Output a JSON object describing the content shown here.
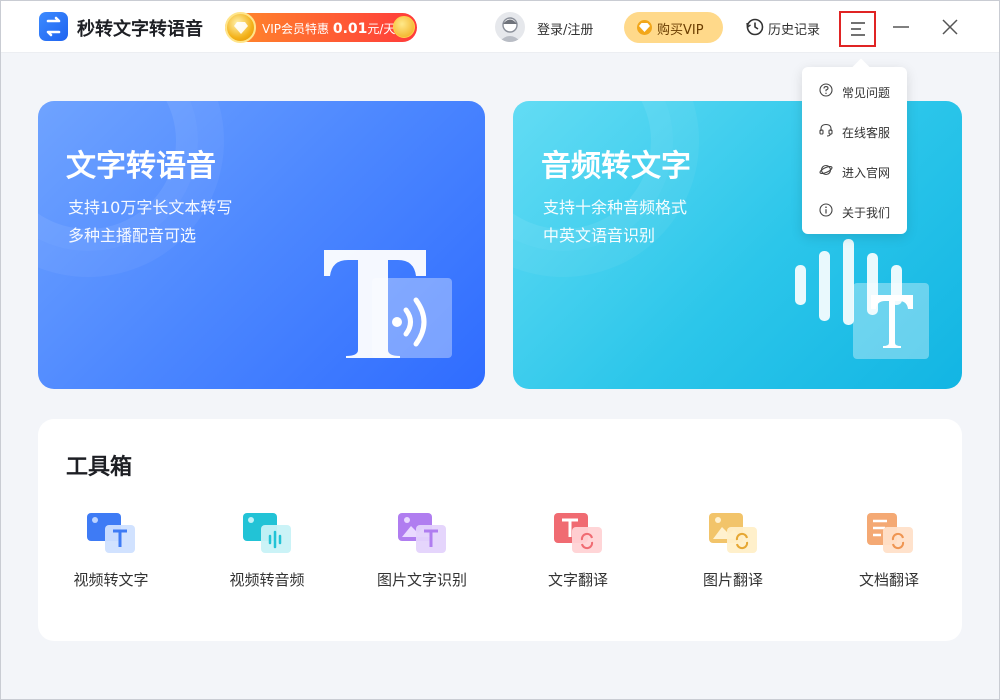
{
  "app": {
    "title": "秒转文字转语音",
    "promo": {
      "text": "VIP会员特惠",
      "price": "0.01",
      "unit": "元/天"
    },
    "login_label": "登录/注册",
    "buy_vip_label": "购买VIP",
    "history_label": "历史记录"
  },
  "colors": {
    "primary": "#2f6cff",
    "cyan": "#12b5e3",
    "vip_gold": "#ffd98a",
    "promo_red": "#ff3b3b",
    "menu_highlight": "#e02424"
  },
  "dropdown": {
    "items": [
      {
        "label": "常见问题",
        "icon": "question-circle-icon"
      },
      {
        "label": "在线客服",
        "icon": "headset-icon"
      },
      {
        "label": "进入官网",
        "icon": "planet-icon"
      },
      {
        "label": "关于我们",
        "icon": "info-circle-icon"
      }
    ]
  },
  "cards": [
    {
      "title": "文字转语音",
      "line1": "支持10万字长文本转写",
      "line2": "多种主播配音可选"
    },
    {
      "title": "音频转文字",
      "line1": "支持十余种音频格式",
      "line2": "中英文语音识别"
    }
  ],
  "toolbox": {
    "title": "工具箱",
    "tools": [
      {
        "label": "视频转文字",
        "icon": "video-to-text-icon"
      },
      {
        "label": "视频转音频",
        "icon": "video-to-audio-icon"
      },
      {
        "label": "图片文字识别",
        "icon": "image-ocr-icon"
      },
      {
        "label": "文字翻译",
        "icon": "text-translate-icon"
      },
      {
        "label": "图片翻译",
        "icon": "image-translate-icon"
      },
      {
        "label": "文档翻译",
        "icon": "document-translate-icon"
      }
    ]
  }
}
